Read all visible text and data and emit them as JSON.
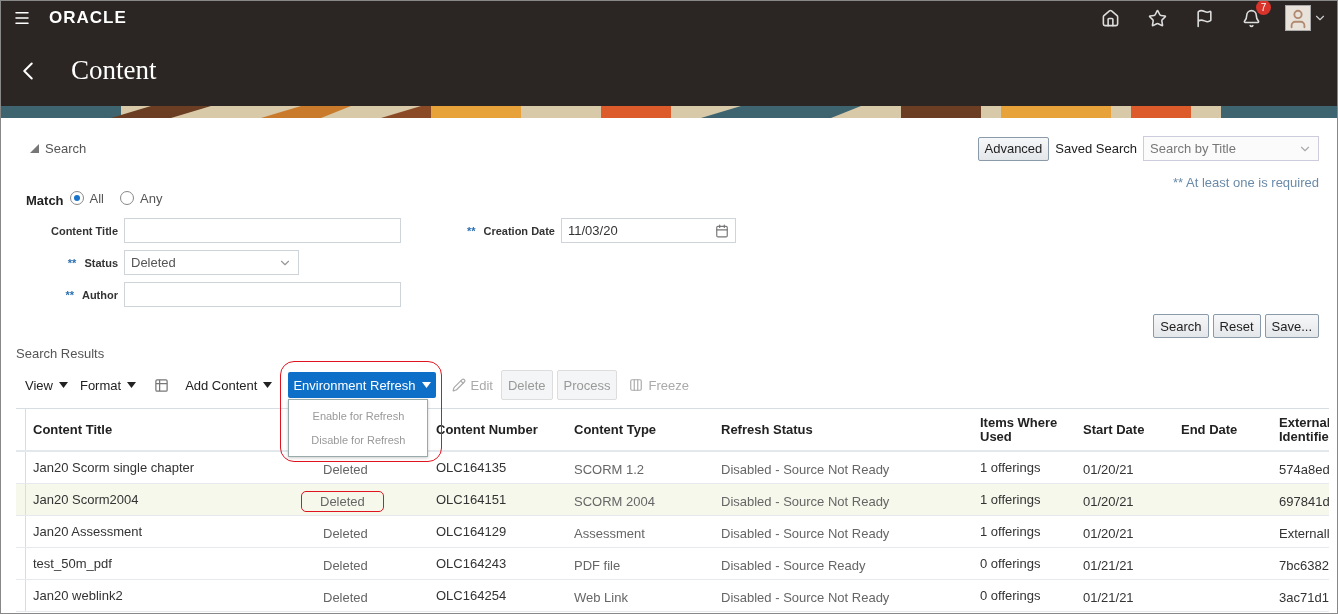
{
  "header": {
    "brand": "ORACLE",
    "notification_count": "7"
  },
  "page_title": "Content",
  "search": {
    "title": "Search",
    "expanded": true,
    "advanced_button": "Advanced",
    "saved_search_label": "Saved Search",
    "saved_search_placeholder": "Search by Title",
    "required_note": "** At least one is required",
    "match": {
      "label": "Match",
      "options": [
        {
          "label": "All",
          "selected": true
        },
        {
          "label": "Any",
          "selected": false
        }
      ]
    },
    "left_fields": [
      {
        "kind": "text",
        "label": "Content Title"
      },
      {
        "kind": "select",
        "label": "Status",
        "marker": "**",
        "value": "Deleted"
      },
      {
        "kind": "text",
        "label": "Author",
        "marker": "**"
      }
    ],
    "right_fields": [
      {
        "kind": "date",
        "label": "Creation Date",
        "marker": "**",
        "value": "11/03/20"
      }
    ],
    "buttons": [
      "Search",
      "Reset",
      "Save..."
    ]
  },
  "results": {
    "title": "Search Results",
    "toolbar": [
      {
        "kind": "menu",
        "label": "View"
      },
      {
        "kind": "menu",
        "label": "Format"
      },
      {
        "kind": "icon"
      },
      {
        "kind": "menu",
        "label": "Add Content"
      },
      {
        "kind": "primary_menu",
        "label": "Environment Refresh",
        "expanded": true,
        "annotated": true,
        "items": [
          {
            "label": "Enable for Refresh",
            "disabled": true
          },
          {
            "label": "Disable for Refresh",
            "disabled": true
          }
        ]
      },
      {
        "kind": "icon_button",
        "label": "Edit",
        "disabled": true
      },
      {
        "kind": "button",
        "label": "Delete",
        "disabled": true
      },
      {
        "kind": "button",
        "label": "Process",
        "disabled": true
      },
      {
        "kind": "icon_button",
        "label": "Freeze",
        "disabled": true
      }
    ],
    "columns": [
      {
        "label": "Content Title"
      },
      {},
      {
        "label": "Content Number"
      },
      {
        "label": "Content Type"
      },
      {
        "label": "Refresh Status"
      },
      {
        "label": "Items Where Used"
      },
      {
        "label": "Start Date"
      },
      {
        "label": "End Date"
      },
      {
        "label": "External Identifie"
      }
    ],
    "rows": [
      {
        "selected": false,
        "cells": [
          "Jan20 Scorm single chapter",
          "Deleted",
          "OLC164135",
          "SCORM 1.2",
          "Disabled - Source Not Ready",
          "1 offerings",
          "01/20/21",
          "",
          "574a8ed"
        ]
      },
      {
        "selected": true,
        "status_annotated": true,
        "cells": [
          "Jan20 Scorm2004",
          "Deleted",
          "OLC164151",
          "SCORM 2004",
          "Disabled - Source Not Ready",
          "1 offerings",
          "01/20/21",
          "",
          "697841d"
        ]
      },
      {
        "selected": false,
        "cells": [
          "Jan20 Assessment",
          "Deleted",
          "OLC164129",
          "Assessment",
          "Disabled - Source Not Ready",
          "1 offerings",
          "01/20/21",
          "",
          "Externall"
        ]
      },
      {
        "selected": false,
        "cells": [
          "test_50m_pdf",
          "Deleted",
          "OLC164243",
          "PDF file",
          "Disabled - Source Ready",
          "0 offerings",
          "01/21/21",
          "",
          "7bc6382"
        ]
      },
      {
        "selected": false,
        "cells": [
          "Jan20 weblink2",
          "Deleted",
          "OLC164254",
          "Web Link",
          "Disabled - Source Not Ready",
          "0 offerings",
          "01/21/21",
          "",
          "3ac71d1"
        ]
      }
    ]
  }
}
